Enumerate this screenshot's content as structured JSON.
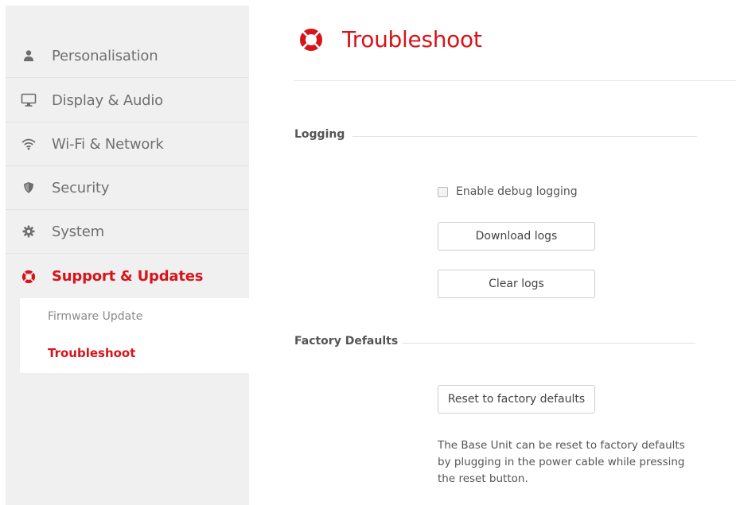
{
  "colors": {
    "accent": "#d8141b",
    "sidebar_bg": "#f0f0f0",
    "text_muted": "#707070"
  },
  "sidebar": {
    "items": [
      {
        "label": "Personalisation",
        "icon": "person-icon"
      },
      {
        "label": "Display & Audio",
        "icon": "monitor-icon"
      },
      {
        "label": "Wi-Fi & Network",
        "icon": "wifi-icon"
      },
      {
        "label": "Security",
        "icon": "shield-icon"
      },
      {
        "label": "System",
        "icon": "gear-icon"
      },
      {
        "label": "Support & Updates",
        "icon": "lifebuoy-icon",
        "active": true
      }
    ],
    "sub_items": [
      {
        "label": "Firmware Update"
      },
      {
        "label": "Troubleshoot",
        "active": true
      }
    ]
  },
  "main": {
    "title": "Troubleshoot",
    "title_icon": "lifebuoy-icon",
    "logging": {
      "heading": "Logging",
      "debug_checkbox": {
        "label": "Enable debug logging",
        "checked": false
      },
      "download_button": "Download logs",
      "clear_button": "Clear logs"
    },
    "factory": {
      "heading": "Factory Defaults",
      "reset_button": "Reset to factory defaults",
      "note": "The Base Unit can be reset to factory defaults by plugging in the power cable while pressing the reset button."
    }
  }
}
